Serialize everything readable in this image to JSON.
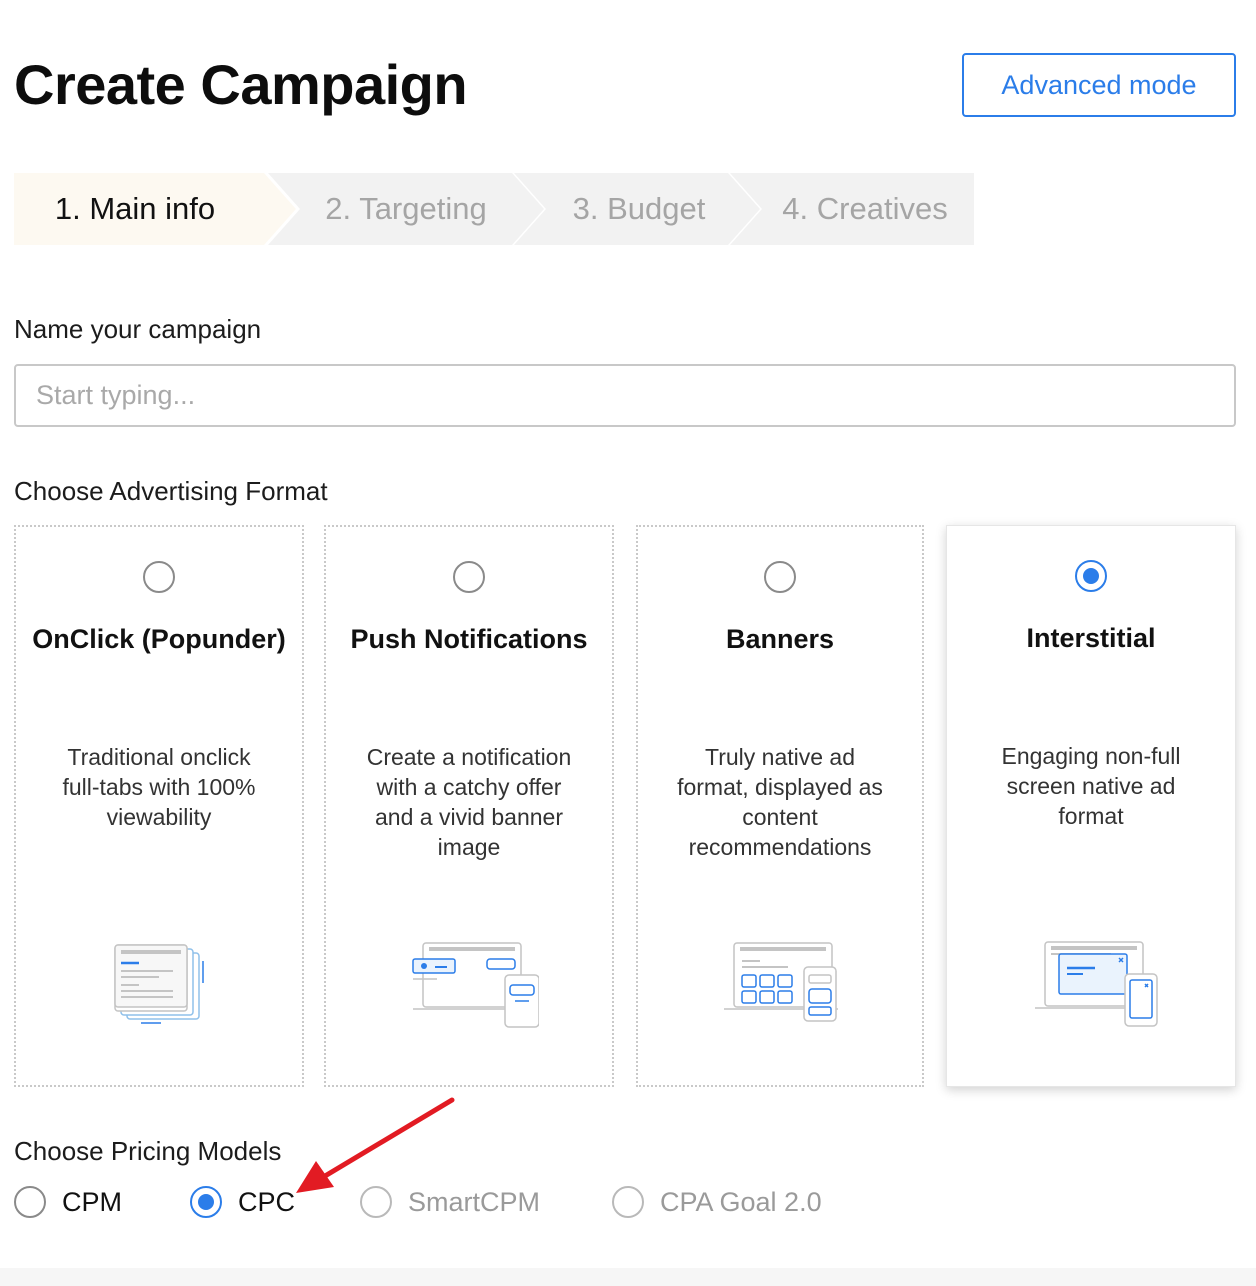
{
  "header": {
    "title": "Create Campaign",
    "advanced_mode_label": "Advanced mode"
  },
  "steps": [
    {
      "label": "1. Main info",
      "state": "active"
    },
    {
      "label": "2. Targeting",
      "state": "inactive"
    },
    {
      "label": "3. Budget",
      "state": "inactive"
    },
    {
      "label": "4. Creatives",
      "state": "inactive"
    }
  ],
  "name_field": {
    "label": "Name your campaign",
    "placeholder": "Start typing...",
    "value": ""
  },
  "formats": {
    "label": "Choose Advertising Format",
    "cards": [
      {
        "title": "OnClick (Popunder)",
        "description": "Traditional onclick full-tabs with 100% viewability",
        "selected": false,
        "icon": "onclick-illustration-icon"
      },
      {
        "title": "Push Notifications",
        "description": "Create a notification with a catchy offer and a vivid banner image",
        "selected": false,
        "icon": "push-illustration-icon"
      },
      {
        "title": "Banners",
        "description": "Truly native ad format, displayed as content recommendations",
        "selected": false,
        "icon": "banner-illustration-icon"
      },
      {
        "title": "Interstitial",
        "description": "Engaging non-full screen native ad format",
        "selected": true,
        "icon": "interstitial-illustration-icon"
      }
    ]
  },
  "pricing": {
    "label": "Choose Pricing Models",
    "options": [
      {
        "label": "CPM",
        "selected": false,
        "enabled": true
      },
      {
        "label": "CPC",
        "selected": true,
        "enabled": true
      },
      {
        "label": "SmartCPM",
        "selected": false,
        "enabled": false
      },
      {
        "label": "CPA Goal 2.0",
        "selected": false,
        "enabled": false
      }
    ]
  },
  "colors": {
    "accent": "#2b7de9",
    "active_step_bg": "#fdf9f1",
    "inactive_step_bg": "#f2f2f2",
    "annotation_arrow": "#e21b23"
  }
}
